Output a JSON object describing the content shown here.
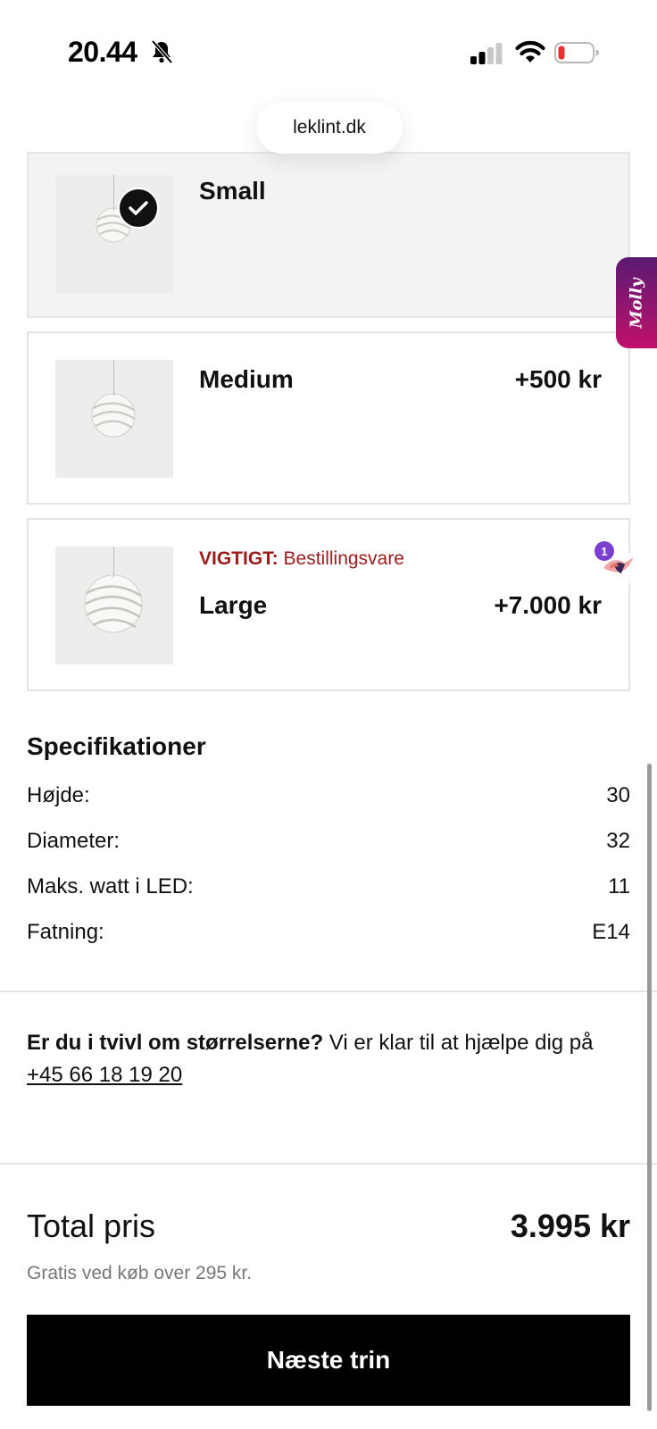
{
  "status_bar": {
    "time": "20.44",
    "bell_icon": "bell-slash-icon",
    "signal_icon": "cellular-signal-icon",
    "wifi_icon": "wifi-icon",
    "battery_icon": "battery-low-icon"
  },
  "browser": {
    "url": "leklint.dk"
  },
  "options": [
    {
      "name": "Small",
      "price": "",
      "selected": true
    },
    {
      "name": "Medium",
      "price": "+500 kr",
      "selected": false
    },
    {
      "name": "Large",
      "price": "+7.000 kr",
      "selected": false,
      "notice_label": "VIGTIGT:",
      "notice_text": "Bestillingsvare"
    }
  ],
  "widgets": {
    "molly_label": "Molly",
    "bird_count": "1"
  },
  "specs": {
    "title": "Specifikationer",
    "rows": [
      {
        "label": "Højde:",
        "value": "30"
      },
      {
        "label": "Diameter:",
        "value": "32"
      },
      {
        "label": "Maks. watt i LED:",
        "value": "11"
      },
      {
        "label": "Fatning:",
        "value": "E14"
      }
    ]
  },
  "help": {
    "question": "Er du i tvivl om størrelserne?",
    "text": " Vi er klar til at hjælpe dig på ",
    "phone": "+45 66 18 19 20"
  },
  "total": {
    "label": "Total pris",
    "value": "3.995 kr",
    "shipping_note": "Gratis ved køb over 295 kr."
  },
  "next_button": {
    "label": "Næste trin"
  },
  "colors": {
    "notice": "#9b1b1b",
    "button_bg": "#000000",
    "molly_gradient_top": "#5b1a73",
    "molly_gradient_bottom": "#c0116b",
    "badge": "#7b3fd0"
  }
}
